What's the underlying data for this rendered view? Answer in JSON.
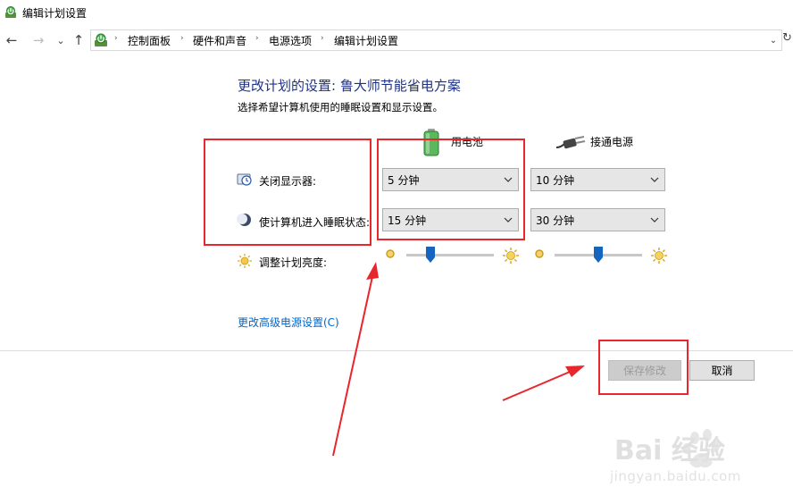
{
  "window": {
    "title": "编辑计划设置"
  },
  "addressbar": {
    "back": "←",
    "forward": "→",
    "recent": "⌄",
    "up": "↑",
    "crumbs": [
      "控制面板",
      "硬件和声音",
      "电源选项",
      "编辑计划设置"
    ],
    "separator": "›",
    "dropdown": "⌄",
    "refresh": "↻"
  },
  "main": {
    "title": "更改计划的设置: 鲁大师节能省电方案",
    "subtitle": "选择希望计算机使用的睡眠设置和显示设置。",
    "columns": {
      "battery": "用电池",
      "plugged": "接通电源"
    },
    "rows": {
      "display_off": {
        "label": "关闭显示器:",
        "battery_value": "5 分钟",
        "plugged_value": "10 分钟"
      },
      "sleep": {
        "label": "使计算机进入睡眠状态:",
        "battery_value": "15 分钟",
        "plugged_value": "30 分钟"
      },
      "brightness": {
        "label": "调整计划亮度:",
        "battery_level": 0.28,
        "plugged_level": 0.5
      }
    },
    "advanced_link": "更改高级电源设置(C)"
  },
  "buttons": {
    "save": "保存修改",
    "cancel": "取消"
  },
  "watermark": {
    "brand": "Bai 经验",
    "url": "jingyan.baidu.com"
  },
  "colors": {
    "title_blue": "#1e3287",
    "link_blue": "#0066cc",
    "annotation_red": "#e8262b",
    "slider_thumb": "#1565c0"
  },
  "icons": {
    "app": "power-plan-icon",
    "battery": "battery-icon",
    "plug": "plug-icon",
    "display": "display-timer-icon",
    "sleep": "moon-icon",
    "brightness": "sun-icon"
  }
}
